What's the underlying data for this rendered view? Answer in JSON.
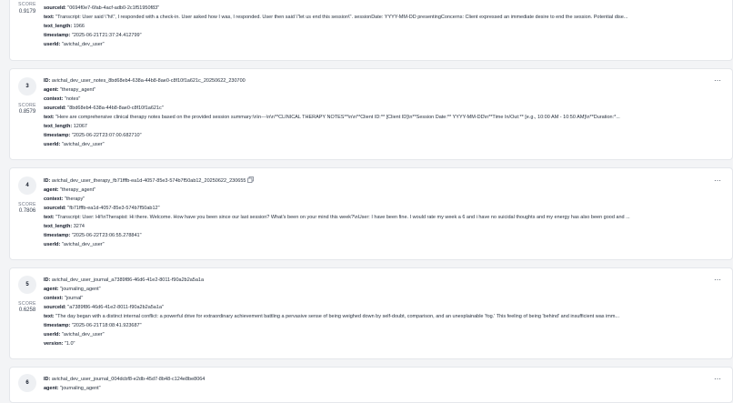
{
  "score_label": "SCORE",
  "menu_icon": "⋯",
  "results": [
    {
      "rank": "",
      "score": "0.9179",
      "fields": [
        {
          "key": "sourceId:",
          "value": " \"0694f0e7-6fab-4acf-adb0-2c1f51950f83\""
        },
        {
          "key": "text:",
          "value": " \"Transcript: User said \\\"hi\\\", I responded with a check-in. User asked how I was, I responded. User then said \\\"let us end this session\\\". sessionDate: YYYY-MM-DD presentingConcerns: Client expressed an immediate desire to end the session. Potential dise..."
        },
        {
          "key": "text_length:",
          "value": " 1966"
        },
        {
          "key": "timestamp:",
          "value": " \"2025-06-21T21:37:24.412799\""
        },
        {
          "key": "userId:",
          "value": " \"avichal_dev_user\""
        }
      ]
    },
    {
      "rank": "3",
      "score": "0.8579",
      "fields": [
        {
          "key": "ID:",
          "value": " avichal_dev_user_notes_8bd68eb4-638a-44b8-8ae0-c8f10f1a621c_20250622_230700"
        },
        {
          "key": "agent:",
          "value": " \"therapy_agent\""
        },
        {
          "key": "context:",
          "value": " \"notes\""
        },
        {
          "key": "sourceId:",
          "value": " \"8bd68eb4-638a-44b8-8ae0-c8f10f1a621c\""
        },
        {
          "key": "text:",
          "value": " \"Here are comprehensive clinical therapy notes based on the provided session summary:\\n\\n---\\n\\n**CLINICAL THERAPY NOTES**\\n\\n**Client ID:** [Client ID]\\n**Session Date:** YYYY-MM-DD\\n**Time In/Out:** [e.g., 10:00 AM - 10:50 AM]\\n**Duration:*..."
        },
        {
          "key": "text_length:",
          "value": " 12067"
        },
        {
          "key": "timestamp:",
          "value": " \"2025-06-22T23:07:00.682710\""
        },
        {
          "key": "userId:",
          "value": " \"avichal_dev_user\""
        }
      ]
    },
    {
      "rank": "4",
      "score": "0.7806",
      "fields": [
        {
          "key": "ID:",
          "value": " avichal_dev_user_therapy_fb71fffb-ea1d-4057-85e3-574b7f50ab12_20250622_230655"
        },
        {
          "key": "agent:",
          "value": " \"therapy_agent\""
        },
        {
          "key": "context:",
          "value": " \"therapy\""
        },
        {
          "key": "sourceId:",
          "value": " \"fb71fffb-ea1d-4057-85e3-574b7f50ab12\""
        },
        {
          "key": "text:",
          "value": " \"Transcript: User: Hi!\\nTherapist: Hi there. Welcome. How have you been since our last session? What's been on your mind this week?\\nUser: I have been fine. I would rate my week a 6 and i have no suicidal thoughts and my energy has also been good and ..."
        },
        {
          "key": "text_length:",
          "value": " 3274"
        },
        {
          "key": "timestamp:",
          "value": " \"2025-06-22T23:06:55.278841\""
        },
        {
          "key": "userId:",
          "value": " \"avichal_dev_user\""
        }
      ]
    },
    {
      "rank": "5",
      "score": "0.6258",
      "fields": [
        {
          "key": "ID:",
          "value": " avichal_dev_user_journal_a7389f86-46d6-41e2-8011-f90a2b2a5a1a"
        },
        {
          "key": "agent:",
          "value": " \"journaling_agent\""
        },
        {
          "key": "context:",
          "value": " \"journal\""
        },
        {
          "key": "sourceId:",
          "value": " \"a7389f86-46d6-41e2-8011-f90a2b2a5a1a\""
        },
        {
          "key": "text:",
          "value": " \"The day began with a distinct internal conflict: a powerful drive for extraordinary achievement battling a pervasive sense of being weighed down by self-doubt, comparison, and an unexplainable 'fog.' This feeling of being 'behind' and insufficient was imm..."
        },
        {
          "key": "timestamp:",
          "value": " \"2025-06-21T18:08:41.923687\""
        },
        {
          "key": "userId:",
          "value": " \"avichal_dev_user\""
        },
        {
          "key": "version:",
          "value": " \"1.0\""
        }
      ]
    },
    {
      "rank": "6",
      "score": "",
      "fields": [
        {
          "key": "ID:",
          "value": " avichal_dev_user_journal_004dcbf8-e2db-45d7-8b48-c124e8be8064"
        },
        {
          "key": "agent:",
          "value": " \"journaling_agent\""
        }
      ]
    }
  ]
}
